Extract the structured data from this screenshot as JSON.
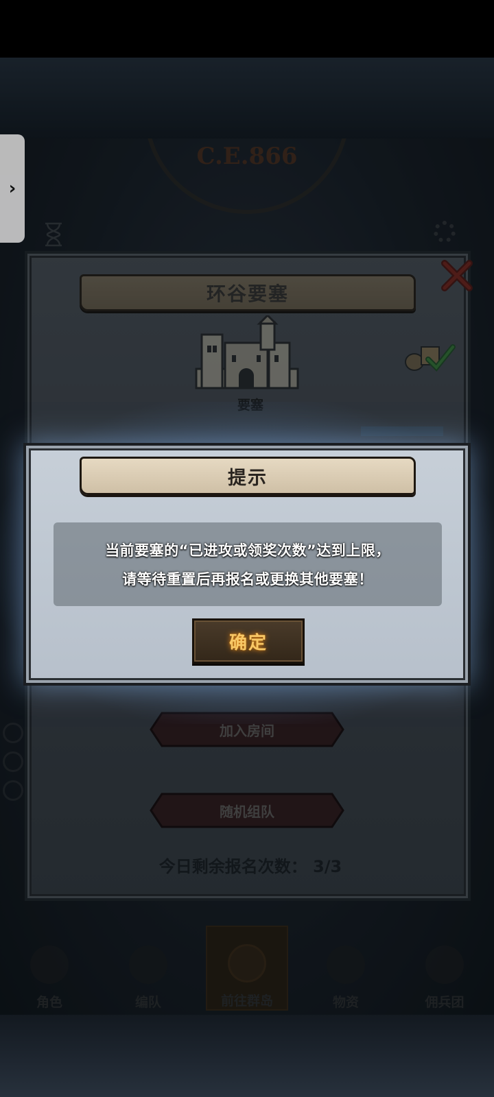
{
  "game": {
    "era_label": "C.E.866",
    "fortress_panel": {
      "title": "环谷要塞",
      "fortress_type_label": "要塞",
      "join_room_label": "加入房间",
      "random_team_label": "随机组队",
      "remaining_signups": "今日剩余报名次数： 3/3"
    },
    "bottom_nav": {
      "items": [
        {
          "label": "角色"
        },
        {
          "label": "编队"
        },
        {
          "label": "前往群岛"
        },
        {
          "label": "物资"
        },
        {
          "label": "佣兵团"
        }
      ]
    }
  },
  "dialog": {
    "title": "提示",
    "message_line_1": "当前要塞的“已进攻或领奖次数”达到上限，",
    "message_line_2": "请等待重置后再报名或更换其他要塞！",
    "confirm_label": "确定"
  },
  "side_tab": {
    "icon": "chevron-right-icon"
  },
  "colors": {
    "confirm_text": "#f8c866",
    "dialog_bg": "#c1cad4",
    "banner": "#d8cab2"
  }
}
